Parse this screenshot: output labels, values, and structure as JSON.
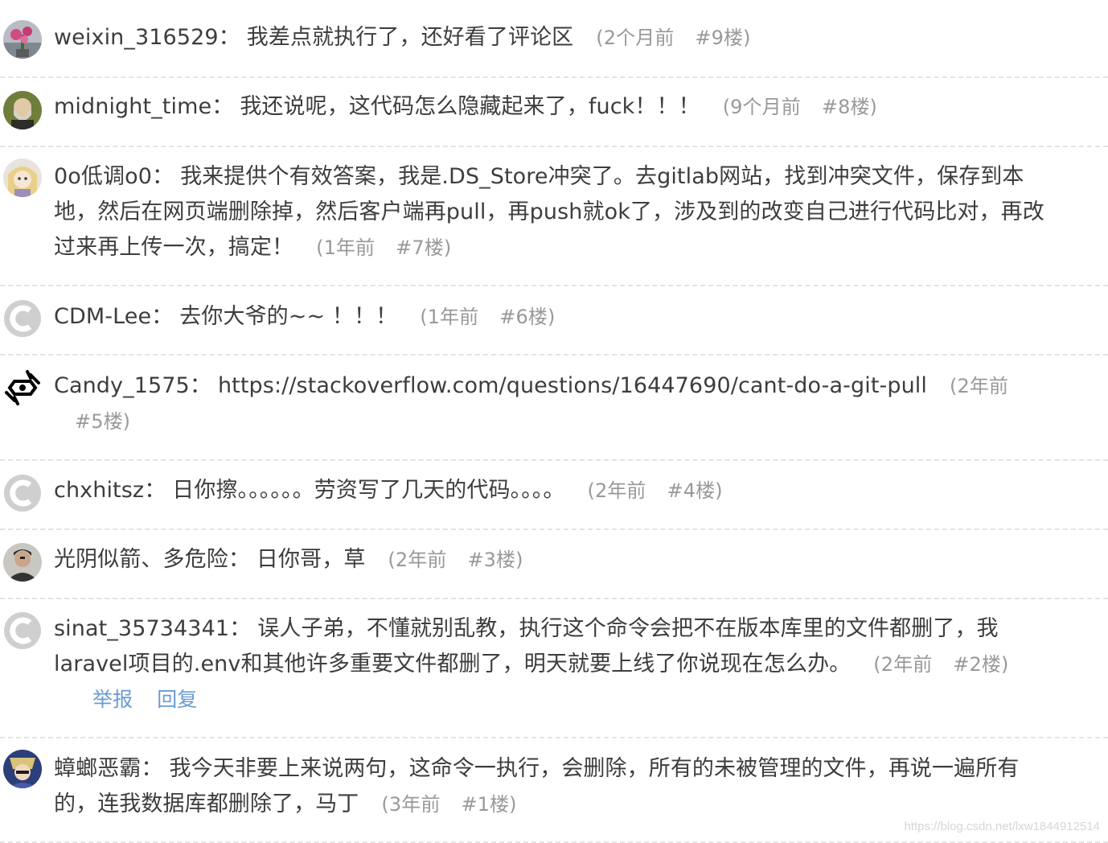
{
  "comments": [
    {
      "user": "weixin_316529",
      "colon": "：",
      "content": "我差点就执行了，还好看了评论区",
      "time": "(2个月前",
      "floor": "#9楼)",
      "avatar": "flower-avatar-icon"
    },
    {
      "user": "midnight_time",
      "colon": "：",
      "content": "我还说呢，这代码怎么隐藏起来了，fuck！！！",
      "time": "(9个月前",
      "floor": "#8楼)",
      "avatar": "bearded-man-avatar-icon"
    },
    {
      "user": "0o低调o0",
      "colon": "：",
      "content": "我来提供个有效答案，我是.DS_Store冲突了。去gitlab网站，找到冲突文件，保存到本地，然后在网页端删除掉，然后客户端再pull，再push就ok了，涉及到的改变自己进行代码比对，再改过来再上传一次，搞定！",
      "time": "(1年前",
      "floor": "#7楼)",
      "avatar": "anime-girl-avatar-icon"
    },
    {
      "user": "CDM-Lee",
      "colon": "：",
      "content": "去你大爷的~~ ！！！",
      "time": "(1年前",
      "floor": "#6楼)",
      "avatar": "csdn-default-avatar-icon"
    },
    {
      "user": "Candy_1575",
      "colon": "：",
      "content": "https://stackoverflow.com/questions/16447690/cant-do-a-git-pull",
      "time": "(2年前",
      "floor": "#5楼)",
      "avatar": "candy-logo-avatar-icon"
    },
    {
      "user": "chxhitsz",
      "colon": "：",
      "content": "日你擦。。。。。。劳资写了几天的代码。。。。",
      "time": "(2年前",
      "floor": "#4楼)",
      "avatar": "csdn-default-avatar-icon"
    },
    {
      "user": "光阴似箭、多危险",
      "colon": "：",
      "content": "日你哥，草",
      "time": "(2年前",
      "floor": "#3楼)",
      "avatar": "man-portrait-avatar-icon"
    },
    {
      "user": "sinat_35734341",
      "colon": "：",
      "content": "误人子弟，不懂就别乱教，执行这个命令会把不在版本库里的文件都删了，我laravel项目的.env和其他许多重要文件都删了，明天就要上线了你说现在怎么办。",
      "time": "(2年前",
      "floor": "#2楼)",
      "avatar": "csdn-default-avatar-icon",
      "actions": {
        "report": "举报",
        "reply": "回复"
      }
    },
    {
      "user": "蟑螂恶霸",
      "colon": "：",
      "content": "我今天非要上来说两句，这命令一执行，会删除，所有的未被管理的文件，再说一遍所有的，连我数据库都删除了，马丁",
      "time": "(3年前",
      "floor": "#1楼)",
      "avatar": "anime-character-avatar-icon"
    }
  ],
  "watermark": "https://blog.csdn.net/lxw1844912514",
  "colors": {
    "meta": "#999999",
    "action": "#6b9bd1",
    "divider": "#e3e3e3",
    "text": "#3d3d3d"
  }
}
